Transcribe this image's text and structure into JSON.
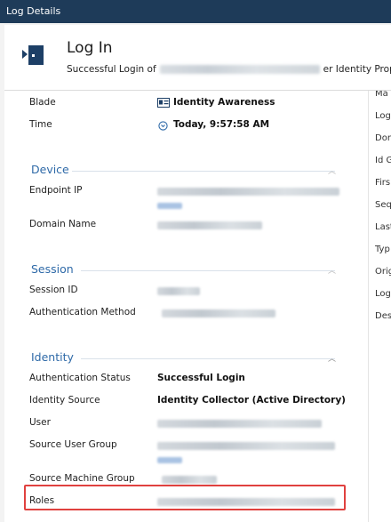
{
  "window": {
    "title": "Log Details"
  },
  "header": {
    "title": "Log In",
    "subtitle_prefix": "Successful Login of",
    "subtitle_suffix": "er Identity Propa"
  },
  "details": {
    "blade_label": "Blade",
    "blade_value": "Identity Awareness",
    "time_label": "Time",
    "time_value": "Today, 9:57:58 AM"
  },
  "device": {
    "title": "Device",
    "endpoint_ip_label": "Endpoint IP",
    "domain_name_label": "Domain Name"
  },
  "session": {
    "title": "Session",
    "session_id_label": "Session ID",
    "auth_method_label": "Authentication Method"
  },
  "identity": {
    "title": "Identity",
    "auth_status_label": "Authentication Status",
    "auth_status_value": "Successful Login",
    "identity_source_label": "Identity Source",
    "identity_source_value": "Identity Collector (Active Directory)",
    "user_label": "User",
    "source_user_group_label": "Source User Group",
    "source_machine_group_label": "Source Machine Group",
    "roles_label": "Roles"
  },
  "right_pane": {
    "items": [
      "Ma",
      "Log",
      "Dor",
      "Id G",
      "Firs",
      "Seq",
      "Last",
      "Typ",
      "Orig",
      "Log",
      "Des"
    ]
  },
  "colors": {
    "titlebar": "#1e3b59",
    "section_title": "#2f6aa8",
    "highlight_box": "#e0413f",
    "icon_blue": "#1d3f66"
  }
}
